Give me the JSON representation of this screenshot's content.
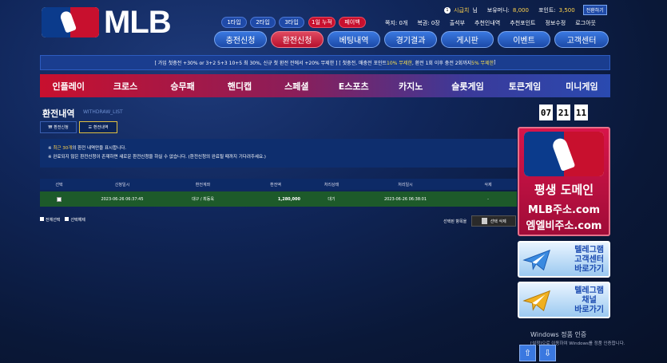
{
  "logo": {
    "text": "MLB"
  },
  "header": {
    "tabs": [
      "1타입",
      "2타입",
      "3타입",
      "1일 누적",
      "페이백"
    ],
    "user": {
      "name": "시급치",
      "suffix": "님",
      "money_label": "보유머니:",
      "money": "8,000",
      "point_label": "포인트:",
      "point": "3,500",
      "convert": "전환하기"
    },
    "links": [
      "쪽지: 0개",
      "복권: 0장",
      "출석부",
      "추천인내역",
      "추천포인트",
      "정보수정",
      "로그아웃"
    ],
    "main_buttons": [
      "충전신청",
      "환전신청",
      "베팅내역",
      "경기결과",
      "게시판",
      "이벤트",
      "고객센터"
    ]
  },
  "notice": {
    "p1": "[ 가입 첫충전 +30% or 3+2  5+3  10+5 최 30%, 신규 첫 환전 전에서 +20% 무제한 ] [ 첫충전, 매충전 포인트 ",
    "h1": "10% 무제한",
    "p2": ", 환전 1회 이후 충전 2회까지 ",
    "h2": "5% 무제한",
    "p3": " ]"
  },
  "categories": [
    "인플레이",
    "크로스",
    "승무패",
    "핸디캡",
    "스페셜",
    "E스포츠",
    "카지노",
    "슬롯게임",
    "토큰게임",
    "미니게임"
  ],
  "page": {
    "title": "환전내역",
    "subtitle": "WITHDRAW_LIST",
    "btn_request": "환전신청",
    "btn_history": "환전내역"
  },
  "info": {
    "l1_prefix": "※ ",
    "l1_hl": "최근 30개",
    "l1_rest": "의 환전 내역만을 표시합니다.",
    "l2": "※ 완료되지 않은 환전신청이 존재하면 새로운 환전신청을 하실 수 없습니다. (환전신청의 완료될 때까지 기다려주세요.)"
  },
  "table": {
    "headers": [
      "선택",
      "신청일시",
      "환전계좌",
      "환전액",
      "처리상태",
      "처리일시",
      "삭제"
    ],
    "row": {
      "date": "2023-06-26 06:37:45",
      "account": "대구 / 최동욱",
      "amount": "1,280,000",
      "status": "대기",
      "proc_date": "2023-06-26 06:38:01",
      "del": "-"
    }
  },
  "footer": {
    "select_all": "전체선택",
    "deselect": "선택해제",
    "del_label": "선택된 항목을",
    "del_btn": "선택 삭제"
  },
  "clock": {
    "h": "07",
    "m": "21",
    "s": "11"
  },
  "banners": {
    "b1_l1": "평생 도메인",
    "b1_l2": "MLB주소.com",
    "b1_l3": "엠엘비주소.com",
    "b2": [
      "텔레그램",
      "고객센터",
      "바로가기"
    ],
    "b3": [
      "텔레그램",
      "채널",
      "바로가기"
    ]
  },
  "windows": {
    "l1": "Windows 정품 인증",
    "l2": "[설정]으로 이동하여 Windows를 정품 인증합니다."
  },
  "colors": {
    "accent": "#c8102e",
    "primary": "#1f4aa8",
    "highlight": "#ffd34d"
  }
}
